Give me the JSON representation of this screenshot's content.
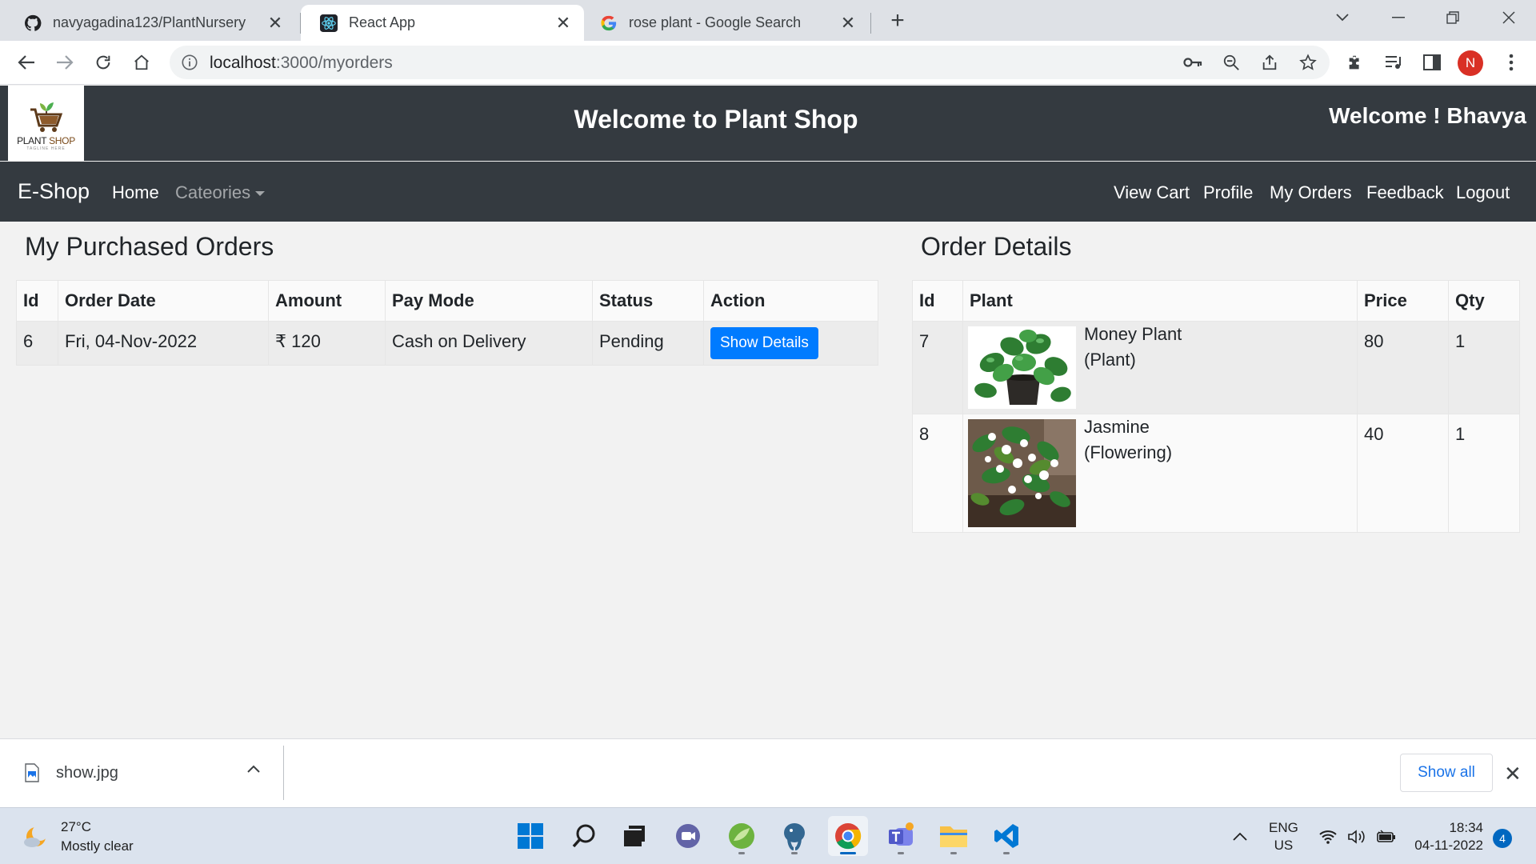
{
  "browser": {
    "tabs": [
      {
        "title": "navyagadina123/PlantNursery",
        "icon": "github-icon",
        "active": false
      },
      {
        "title": "React App",
        "icon": "react-icon",
        "active": true
      },
      {
        "title": "rose plant - Google Search",
        "icon": "google-icon",
        "active": false
      }
    ],
    "address": {
      "host": "localhost",
      "path": ":3000/myorders"
    },
    "profile_initial": "N"
  },
  "app": {
    "logo": {
      "text_plant": "PLANT",
      "text_shop": "SHOP",
      "tagline": "TAGLINE HERE"
    },
    "header_title": "Welcome to Plant Shop",
    "header_user": "Welcome ! Bhavya",
    "brand": "E-Shop",
    "nav_left": {
      "home": "Home",
      "categories": "Cateories"
    },
    "nav_right": {
      "cart": "View Cart",
      "profile": "Profile",
      "orders": "My Orders",
      "feedback": "Feedback",
      "logout": "Logout"
    }
  },
  "orders": {
    "title": "My Purchased Orders",
    "columns": {
      "id": "Id",
      "date": "Order Date",
      "amount": "Amount",
      "paymode": "Pay Mode",
      "status": "Status",
      "action": "Action"
    },
    "rows": [
      {
        "id": "6",
        "date": "Fri, 04-Nov-2022",
        "amount": "₹ 120",
        "paymode": "Cash on Delivery",
        "status": "Pending",
        "action": "Show Details"
      }
    ]
  },
  "details": {
    "title": "Order Details",
    "columns": {
      "id": "Id",
      "plant": "Plant",
      "price": "Price",
      "qty": "Qty"
    },
    "rows": [
      {
        "id": "7",
        "name": "Money Plant",
        "category": "(Plant)",
        "price": "80",
        "qty": "1",
        "image": "money-plant-image"
      },
      {
        "id": "8",
        "name": "Jasmine",
        "category": "(Flowering)",
        "price": "40",
        "qty": "1",
        "image": "jasmine-image"
      }
    ]
  },
  "downloads": {
    "file": "show.jpg",
    "show_all": "Show all"
  },
  "taskbar": {
    "weather_temp": "27°C",
    "weather_desc": "Mostly clear",
    "lang": "ENG",
    "region": "US",
    "time": "18:34",
    "date": "04-11-2022",
    "notifications": "4"
  },
  "colors": {
    "navbar": "#343a40",
    "primary": "#007bff",
    "page_bg": "#f2f2f2"
  }
}
